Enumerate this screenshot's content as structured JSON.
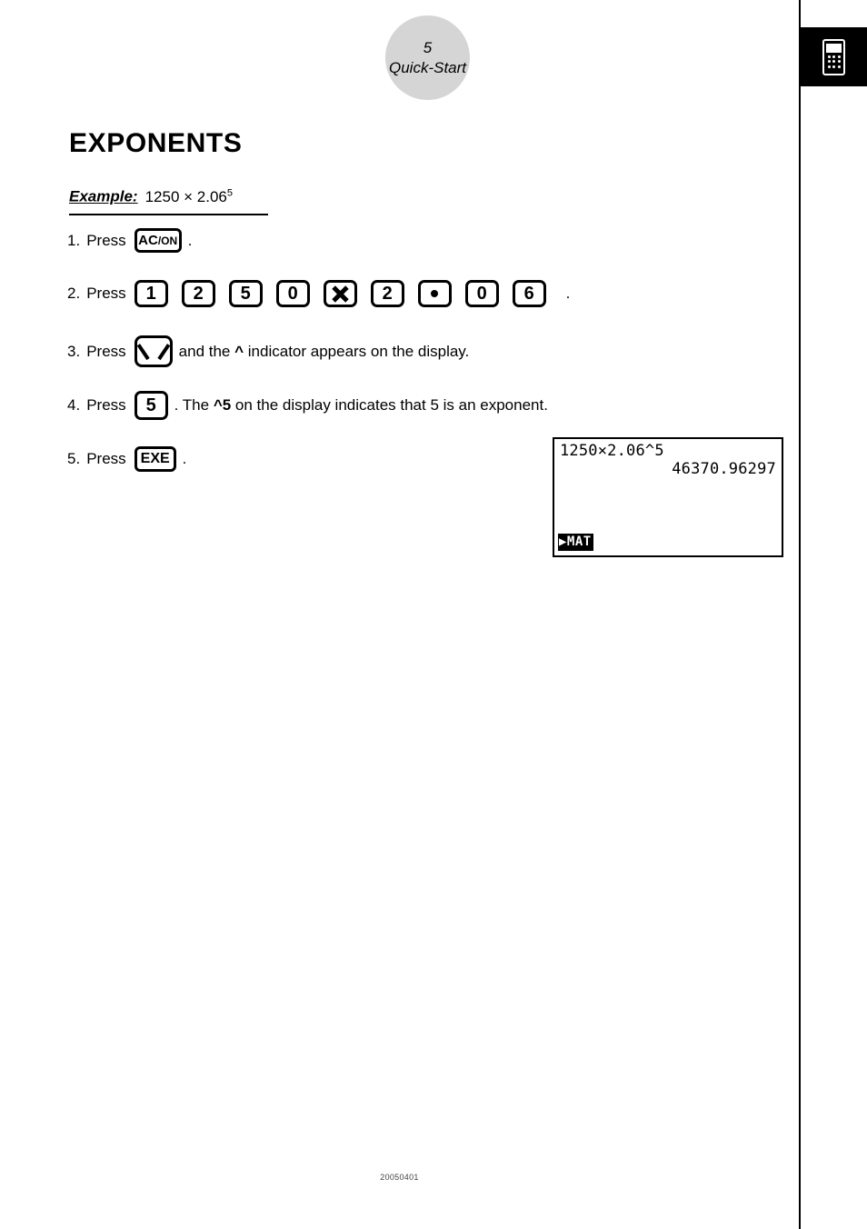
{
  "page": {
    "number": "5",
    "section": "Quick-Start",
    "footer_code": "20050401",
    "tab_icon": "calculator-icon",
    "colors": {
      "page_bubble_fill": "#d5d5d5",
      "tab_fill": "#000000",
      "ink": "#000000"
    }
  },
  "heading": {
    "title": "EXPONENTS"
  },
  "example": {
    "label": "Example:",
    "expression_base": "1250 × 2.06",
    "expression_exponent": "5"
  },
  "steps": [
    {
      "number": "1.",
      "verb": "Press",
      "keys": [
        {
          "name": "key-ac-on",
          "type": "acon",
          "main": "AC",
          "sub": "/ON"
        }
      ],
      "tail": "."
    },
    {
      "number": "2.",
      "verb": "Press",
      "keys": [
        {
          "name": "key-1",
          "type": "digit",
          "label": "1"
        },
        {
          "name": "key-2",
          "type": "digit",
          "label": "2"
        },
        {
          "name": "key-5",
          "type": "digit",
          "label": "5"
        },
        {
          "name": "key-0",
          "type": "digit",
          "label": "0"
        },
        {
          "name": "key-multiply",
          "type": "times",
          "label": "×"
        },
        {
          "name": "key-2",
          "type": "digit",
          "label": "2"
        },
        {
          "name": "key-decimal-point",
          "type": "dot",
          "label": "·"
        },
        {
          "name": "key-0",
          "type": "digit",
          "label": "0"
        },
        {
          "name": "key-6",
          "type": "digit",
          "label": "6"
        }
      ],
      "tail": "."
    },
    {
      "number": "3.",
      "verb": "Press",
      "keys": [
        {
          "name": "key-caret-power",
          "type": "caret",
          "label": "^"
        }
      ],
      "tail_pre": "and the ",
      "tail_bold": "^",
      "tail_post": " indicator appears on the display."
    },
    {
      "number": "4.",
      "verb": "Press",
      "keys": [
        {
          "name": "key-5",
          "type": "five",
          "label": "5"
        }
      ],
      "tail_pre": ". The ",
      "tail_bold": "^5",
      "tail_post": " on the display indicates that 5 is an exponent."
    },
    {
      "number": "5.",
      "verb": "Press",
      "keys": [
        {
          "name": "key-exe",
          "type": "exe",
          "label": "EXE"
        }
      ],
      "tail": "."
    }
  ],
  "lcd": {
    "line_1": "1250×2.06^5",
    "line_2": "46370.96297",
    "menu_tab": "▶MAT"
  }
}
